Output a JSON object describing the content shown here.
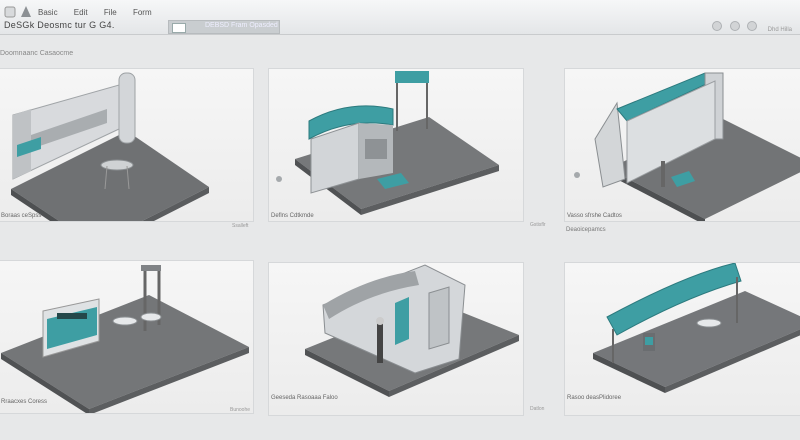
{
  "window": {
    "menu": [
      "Basic",
      "Edit",
      "File",
      "Form"
    ],
    "breadcrumb": "DeSGk Deosmc tur G G4.",
    "address_text": "DEBSD Fram Opasded",
    "tools_label": "Dhd Hilla"
  },
  "section": {
    "title": "Doomnaanc Casaocme"
  },
  "cards": [
    {
      "caption": "Boraas ceSpss",
      "sub": "",
      "link": "Ssalleft"
    },
    {
      "caption": "Deflns Cdtkmde",
      "sub": "",
      "link": ""
    },
    {
      "caption": "Vasso sfrshe Cadtos",
      "sub": "Deaoicepamcs",
      "link": "Gstisflr"
    },
    {
      "caption": "Rraacxes Coress",
      "sub": "",
      "link": ""
    },
    {
      "caption": "Geeseda Rasoaaa Faloo",
      "sub": "",
      "link": "Bunoohe"
    },
    {
      "caption": "Rasoo deasPlidoree",
      "sub": "",
      "link": "Datlon"
    }
  ],
  "colors": {
    "teal": "#3e9ea3",
    "floor": "#6f7173",
    "panel": "#c4c7ca"
  }
}
